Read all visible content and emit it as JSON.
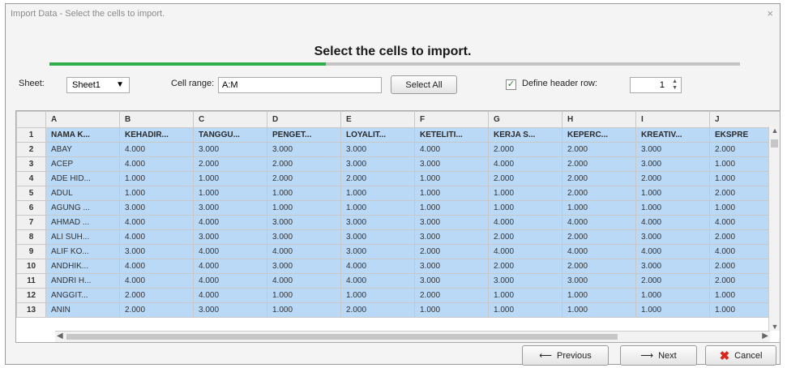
{
  "window": {
    "title": "Import Data - Select the cells to import.",
    "close_glyph": "×"
  },
  "heading": "Select the cells to import.",
  "progress": {
    "fraction": 0.4,
    "color": "#2db04b"
  },
  "sheet": {
    "label": "Sheet:",
    "value": "Sheet1"
  },
  "cell_range": {
    "label": "Cell range:",
    "value": "A:M"
  },
  "select_all_label": "Select All",
  "header_row": {
    "label": "Define header row:",
    "checked": true,
    "value": "1"
  },
  "table": {
    "columns": [
      "A",
      "B",
      "C",
      "D",
      "E",
      "F",
      "G",
      "H",
      "I",
      "J"
    ],
    "rows": [
      {
        "num": "1",
        "cells": [
          "NAMA K...",
          "KEHADIR...",
          "TANGGU...",
          "PENGET...",
          "LOYALIT...",
          "KETELITI...",
          "KERJA S...",
          "KEPERC...",
          "KREATIV...",
          "EKSPRE"
        ]
      },
      {
        "num": "2",
        "cells": [
          "ABAY",
          "4.000",
          "3.000",
          "3.000",
          "3.000",
          "4.000",
          "2.000",
          "2.000",
          "3.000",
          "2.000"
        ]
      },
      {
        "num": "3",
        "cells": [
          "ACEP",
          "4.000",
          "2.000",
          "2.000",
          "3.000",
          "3.000",
          "4.000",
          "2.000",
          "3.000",
          "1.000"
        ]
      },
      {
        "num": "4",
        "cells": [
          "ADE HID...",
          "1.000",
          "1.000",
          "2.000",
          "2.000",
          "1.000",
          "2.000",
          "2.000",
          "2.000",
          "1.000"
        ]
      },
      {
        "num": "5",
        "cells": [
          "ADUL",
          "1.000",
          "1.000",
          "1.000",
          "1.000",
          "1.000",
          "1.000",
          "2.000",
          "1.000",
          "2.000"
        ]
      },
      {
        "num": "6",
        "cells": [
          "AGUNG ...",
          "3.000",
          "3.000",
          "1.000",
          "1.000",
          "1.000",
          "1.000",
          "1.000",
          "1.000",
          "1.000"
        ]
      },
      {
        "num": "7",
        "cells": [
          "AHMAD ...",
          "4.000",
          "4.000",
          "3.000",
          "3.000",
          "3.000",
          "4.000",
          "4.000",
          "4.000",
          "4.000"
        ]
      },
      {
        "num": "8",
        "cells": [
          "ALI SUH...",
          "4.000",
          "3.000",
          "3.000",
          "3.000",
          "3.000",
          "2.000",
          "2.000",
          "3.000",
          "2.000"
        ]
      },
      {
        "num": "9",
        "cells": [
          "ALIF KO...",
          "3.000",
          "4.000",
          "4.000",
          "3.000",
          "2.000",
          "4.000",
          "4.000",
          "4.000",
          "4.000"
        ]
      },
      {
        "num": "10",
        "cells": [
          "ANDHIK...",
          "4.000",
          "4.000",
          "3.000",
          "4.000",
          "3.000",
          "2.000",
          "2.000",
          "3.000",
          "2.000"
        ]
      },
      {
        "num": "11",
        "cells": [
          "ANDRI H...",
          "4.000",
          "4.000",
          "4.000",
          "4.000",
          "3.000",
          "3.000",
          "3.000",
          "2.000",
          "2.000"
        ]
      },
      {
        "num": "12",
        "cells": [
          "ANGGIT...",
          "2.000",
          "4.000",
          "1.000",
          "1.000",
          "2.000",
          "1.000",
          "1.000",
          "1.000",
          "1.000"
        ]
      },
      {
        "num": "13",
        "cells": [
          "ANIN",
          "2.000",
          "3.000",
          "1.000",
          "2.000",
          "1.000",
          "1.000",
          "1.000",
          "1.000",
          "1.000"
        ]
      }
    ]
  },
  "buttons": {
    "previous": "Previous",
    "next": "Next",
    "cancel": "Cancel"
  },
  "icons": {
    "previous": "arrow-left-icon",
    "next": "arrow-right-icon",
    "cancel": "red-x-icon",
    "checkbox": "check-icon"
  },
  "colors": {
    "selection": "#b9d9f7",
    "cancel_icon": "#d9261c"
  }
}
